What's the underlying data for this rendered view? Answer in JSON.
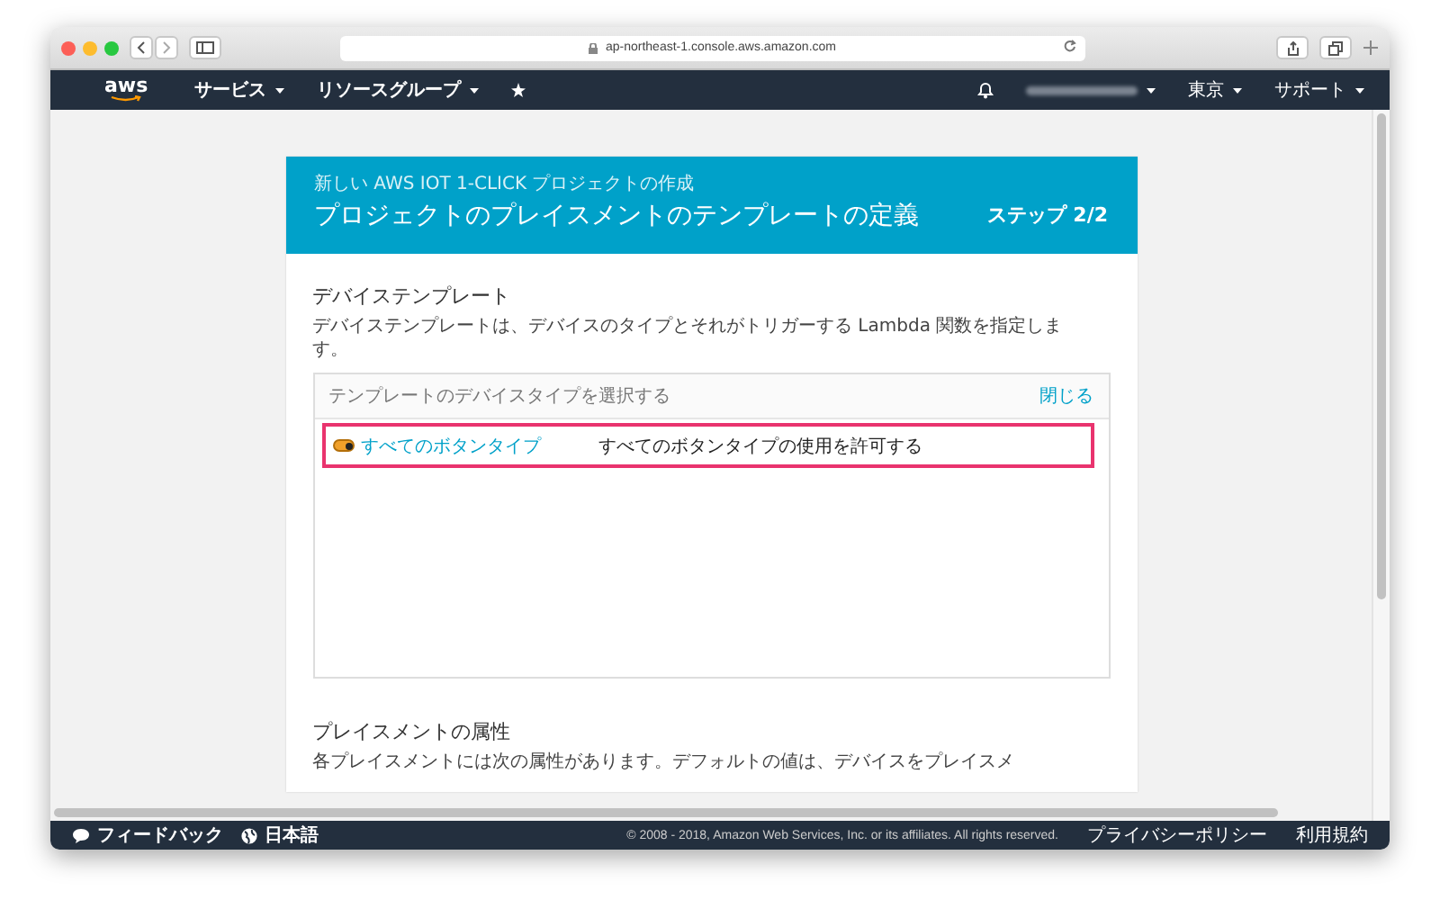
{
  "browser": {
    "url": "ap-northeast-1.console.aws.amazon.com"
  },
  "nav": {
    "logo": "aws",
    "menus": [
      {
        "label": "サービス"
      },
      {
        "label": "リソースグループ"
      }
    ],
    "right_menus": [
      {
        "label": "東京"
      },
      {
        "label": "サポート"
      }
    ]
  },
  "wizard": {
    "breadcrumb": "新しい AWS IOT 1-CLICK プロジェクトの作成",
    "title": "プロジェクトのプレイスメントのテンプレートの定義",
    "step": "ステップ 2/2",
    "device_section": {
      "heading": "デバイステンプレート",
      "description": "デバイステンプレートは、デバイスのタイプとそれがトリガーする Lambda 関数を指定します。",
      "panel": {
        "header": "テンプレートのデバイスタイプを選択する",
        "close": "閉じる",
        "options": [
          {
            "label": "すべてのボタンタイプ",
            "description": "すべてのボタンタイプの使用を許可する",
            "on": true,
            "selected": true
          }
        ]
      }
    },
    "placement_section": {
      "heading": "プレイスメントの属性",
      "description": "各プレイスメントには次の属性があります。デフォルトの値は、デバイスをプレイスメ"
    }
  },
  "footer": {
    "feedback": "フィードバック",
    "language": "日本語",
    "copyright": "© 2008 - 2018, Amazon Web Services, Inc. or its affiliates. All rights reserved.",
    "links": [
      {
        "label": "プライバシーポリシー"
      },
      {
        "label": "利用規約"
      }
    ]
  }
}
